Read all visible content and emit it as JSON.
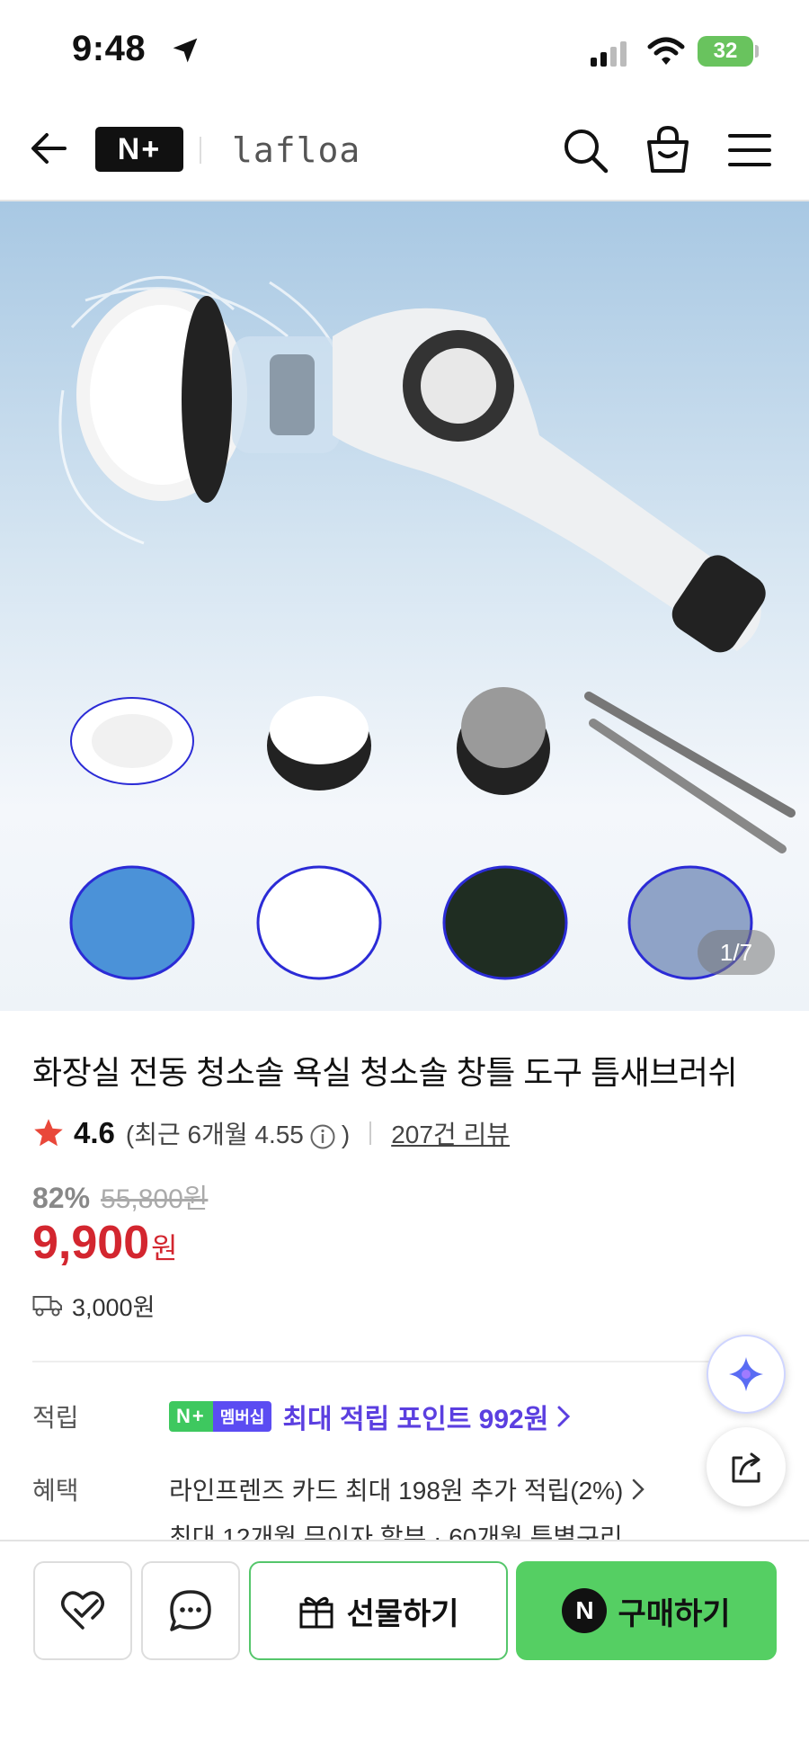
{
  "status_bar": {
    "time": "9:48",
    "battery": "32"
  },
  "header": {
    "logo": "N+",
    "store_name": "lafloa"
  },
  "product": {
    "image_counter": "1/7",
    "title": "화장실 전동 청소솔 욕실 청소솔 창틀 도구 틈새브러쉬",
    "rating": "4.6",
    "recent_rating_prefix": "(최근 6개월 4.55",
    "recent_rating_suffix": ")",
    "review_link": "207건 리뷰",
    "discount_rate": "82%",
    "original_price": "55,800원",
    "sale_price": "9,900",
    "price_unit": "원",
    "shipping_fee": "3,000원"
  },
  "points": {
    "label": "적립",
    "badge_np": "N+",
    "badge_member": "멤버십",
    "text": "최대 적립 포인트 992원"
  },
  "benefits": {
    "label": "혜택",
    "line1": "라인프렌즈 카드 최대 198원 추가 적립(2%)",
    "line2": "최대 12개월 무이자 할부 · 60개월 특별구리"
  },
  "bottom_bar": {
    "gift_label": "선물하기",
    "buy_label": "구매하기",
    "buy_icon_letter": "N"
  },
  "colors": {
    "sale_red": "#d3262f",
    "point_purple": "#5b3fe0",
    "buy_green": "#55cf63",
    "np_green": "#3ec85f"
  },
  "icons": [
    "location-arrow-icon",
    "signal-icon",
    "wifi-icon",
    "battery-icon",
    "back-arrow-icon",
    "search-icon",
    "shopping-bag-icon",
    "hamburger-menu-icon",
    "star-icon",
    "info-icon",
    "truck-icon",
    "chevron-right-icon",
    "ai-sparkle-icon",
    "share-icon",
    "heart-check-icon",
    "chat-bubble-icon",
    "gift-icon"
  ]
}
